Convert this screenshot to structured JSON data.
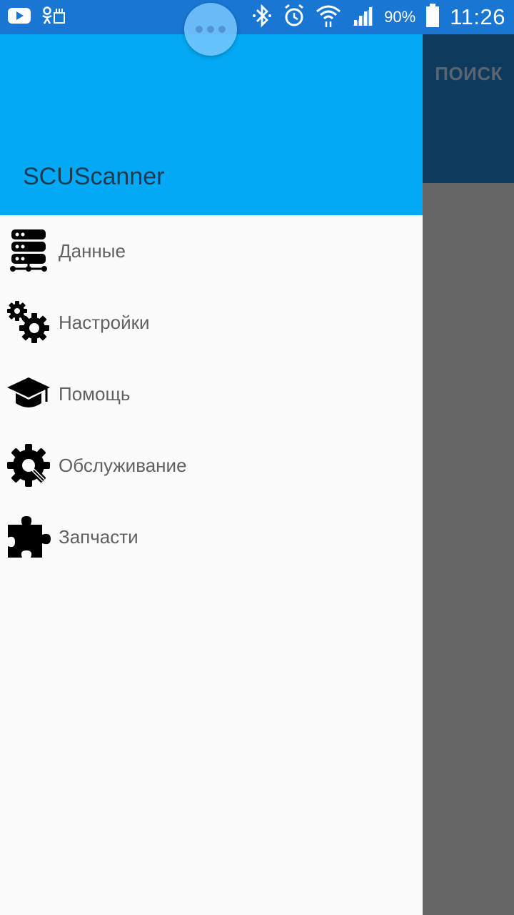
{
  "status_bar": {
    "battery": "90%",
    "time": "11:26"
  },
  "toolbar": {
    "search_tab": "ПОИСК"
  },
  "drawer": {
    "title": "SCUScanner",
    "items": [
      {
        "label": "Данные",
        "icon": "server-icon"
      },
      {
        "label": "Настройки",
        "icon": "gears-icon"
      },
      {
        "label": "Помощь",
        "icon": "graduation-cap-icon"
      },
      {
        "label": "Обслуживание",
        "icon": "gear-wrench-icon"
      },
      {
        "label": "Запчасти",
        "icon": "puzzle-piece-icon"
      }
    ]
  },
  "colors": {
    "status_bar": "#1976d2",
    "drawer_header": "#03a9f4",
    "toolbar": "#0e3a5e",
    "scrim": "#666666",
    "drawer_bg": "#fafafa"
  }
}
